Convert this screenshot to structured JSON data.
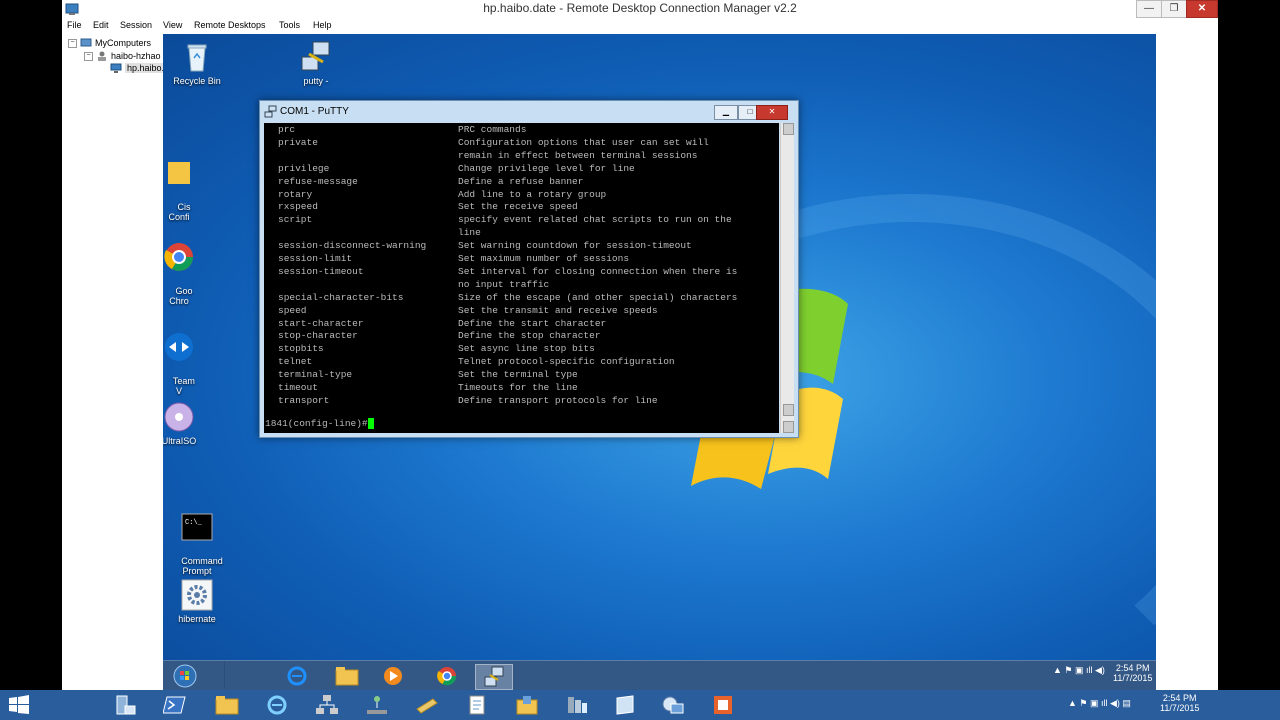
{
  "window": {
    "title": "hp.haibo.date - Remote Desktop Connection Manager v2.2",
    "min_label": "—",
    "max_label": "❐",
    "close_label": "✕"
  },
  "menu": [
    "File",
    "Edit",
    "Session",
    "View",
    "Remote Desktops",
    "Tools",
    "Help"
  ],
  "tree": {
    "root": "MyComputers",
    "group": "haibo-hzhao",
    "server": "hp.haibo.date"
  },
  "desktop_icons": [
    {
      "label": "Recycle Bin",
      "icon": "recycle-bin-icon"
    },
    {
      "label": "putty -",
      "icon": "putty-icon"
    },
    {
      "label": "Cis\nConfi",
      "icon": "cisco-config-icon"
    },
    {
      "label": "Goo\nChro",
      "icon": "chrome-icon"
    },
    {
      "label": "Team\nV",
      "icon": "teamviewer-icon"
    },
    {
      "label": "UltraISO",
      "icon": "ultraiso-icon"
    },
    {
      "label": "Command\nPrompt",
      "icon": "command-prompt-icon"
    },
    {
      "label": "hibernate",
      "icon": "gear-icon"
    }
  ],
  "putty": {
    "title": "COM1 - PuTTY",
    "rows": [
      {
        "cmd": "prc",
        "desc": "PRC commands"
      },
      {
        "cmd": "private",
        "desc": "Configuration options that user can set will"
      },
      {
        "cmd": "",
        "desc": "remain in effect between terminal sessions"
      },
      {
        "cmd": "privilege",
        "desc": "Change privilege level for line"
      },
      {
        "cmd": "refuse-message",
        "desc": "Define a refuse banner"
      },
      {
        "cmd": "rotary",
        "desc": "Add line to a rotary group"
      },
      {
        "cmd": "rxspeed",
        "desc": "Set the receive speed"
      },
      {
        "cmd": "script",
        "desc": "specify event related chat scripts to run on the"
      },
      {
        "cmd": "",
        "desc": "line"
      },
      {
        "cmd": "session-disconnect-warning",
        "desc": "Set warning countdown for session-timeout"
      },
      {
        "cmd": "session-limit",
        "desc": "Set maximum number of sessions"
      },
      {
        "cmd": "session-timeout",
        "desc": "Set interval for closing connection when there is"
      },
      {
        "cmd": "",
        "desc": "no input traffic"
      },
      {
        "cmd": "special-character-bits",
        "desc": "Size of the escape (and other special) characters"
      },
      {
        "cmd": "speed",
        "desc": "Set the transmit and receive speeds"
      },
      {
        "cmd": "start-character",
        "desc": "Define the start character"
      },
      {
        "cmd": "stop-character",
        "desc": "Define the stop character"
      },
      {
        "cmd": "stopbits",
        "desc": "Set async line stop bits"
      },
      {
        "cmd": "telnet",
        "desc": "Telnet protocol-specific configuration"
      },
      {
        "cmd": "terminal-type",
        "desc": "Set the terminal type"
      },
      {
        "cmd": "timeout",
        "desc": "Timeouts for the line"
      },
      {
        "cmd": "transport",
        "desc": "Define transport protocols for line"
      }
    ],
    "prompt": "1841(config-line)#"
  },
  "inner_taskbar": {
    "apps": [
      "start-orb-icon",
      "internet-explorer-icon",
      "file-explorer-icon",
      "media-player-icon",
      "chrome-icon",
      "putty-icon"
    ],
    "time": "2:54 PM",
    "date": "11/7/2015"
  },
  "outer_taskbar": {
    "apps": [
      "windows-start-icon",
      "server-manager-icon",
      "powershell-icon",
      "file-explorer-icon",
      "internet-explorer-icon",
      "network-icon",
      "network-share-icon",
      "folder-icon",
      "notepad-icon",
      "folder-tools-icon",
      "sql-icon",
      "tablet-icon",
      "remote-desktop-manager-icon",
      "office-icon"
    ],
    "time": "2:54 PM",
    "date": "11/7/2015"
  },
  "colors": {
    "desktop": "#1e7ad0",
    "taskbar": "#2a5d9b",
    "close_red": "#c7392e",
    "cursor_green": "#00ff00"
  }
}
